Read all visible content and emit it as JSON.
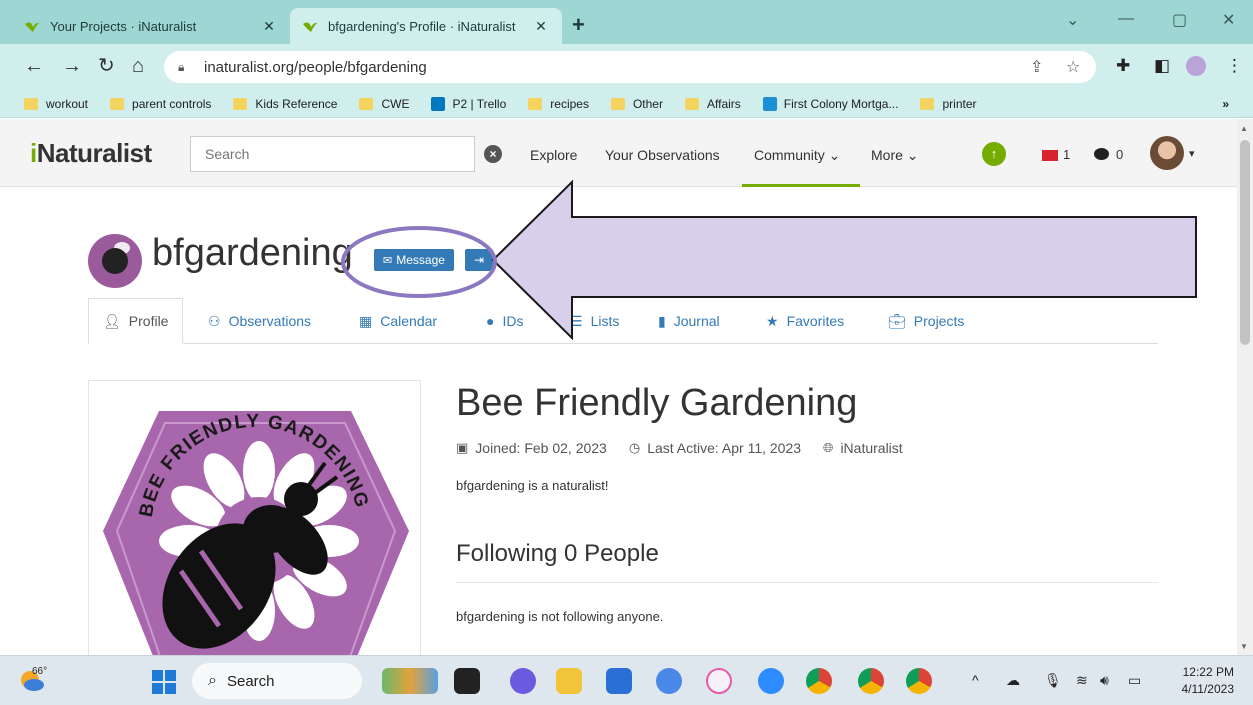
{
  "browser": {
    "tabs": [
      {
        "title": "Your Projects · iNaturalist",
        "active": false
      },
      {
        "title": "bfgardening's Profile · iNaturalist",
        "active": true
      }
    ],
    "new_tab_label": "+",
    "window_controls": {
      "dropdown": "⌄",
      "minimize": "—",
      "restore": "▢",
      "close": "✕"
    },
    "url": "inaturalist.org/people/bfgardening",
    "bookmarks": [
      {
        "label": "workout",
        "icon": "folder-icon"
      },
      {
        "label": "parent controls",
        "icon": "folder-icon"
      },
      {
        "label": "Kids Reference",
        "icon": "folder-icon"
      },
      {
        "label": "CWE",
        "icon": "folder-icon"
      },
      {
        "label": "P2 | Trello",
        "icon": "trello-icon"
      },
      {
        "label": "recipes",
        "icon": "folder-icon"
      },
      {
        "label": "Other",
        "icon": "folder-icon"
      },
      {
        "label": "Affairs",
        "icon": "folder-icon"
      },
      {
        "label": "First Colony Mortga...",
        "icon": "mortgage-icon"
      },
      {
        "label": "printer",
        "icon": "folder-icon"
      }
    ],
    "bookmarks_overflow": "»"
  },
  "site": {
    "logo": {
      "prefix": "i",
      "rest": "Naturalist"
    },
    "search_placeholder": "Search",
    "nav": {
      "explore": "Explore",
      "your_observations": "Your Observations",
      "community": "Community ⌄",
      "more": "More ⌄"
    },
    "messages_count": "1",
    "comments_count": "0",
    "accent_color": "#74ac00"
  },
  "profile": {
    "username": "bfgardening",
    "message_button": "Message",
    "tabs": [
      {
        "label": "Profile",
        "icon": "user-icon"
      },
      {
        "label": "Observations",
        "icon": "binoculars-icon"
      },
      {
        "label": "Calendar",
        "icon": "calendar-icon"
      },
      {
        "label": "IDs",
        "icon": "id-icon"
      },
      {
        "label": "Lists",
        "icon": "list-icon"
      },
      {
        "label": "Journal",
        "icon": "book-icon"
      },
      {
        "label": "Favorites",
        "icon": "star-icon"
      },
      {
        "label": "Projects",
        "icon": "briefcase-icon"
      }
    ],
    "display_name": "Bee Friendly Gardening",
    "joined": "Joined: Feb 02, 2023",
    "last_active": "Last Active: Apr 11, 2023",
    "network": "iNaturalist",
    "bio": "bfgardening is a naturalist!",
    "following_title": "Following 0 People",
    "following_empty": "bfgardening is not following anyone.",
    "badge_text": {
      "arc": "BEE FRIENDLY GARDENING",
      "tm": "™"
    }
  },
  "taskbar": {
    "temperature": "66°",
    "search_label": "Search",
    "time": "12:22 PM",
    "date": "4/11/2023"
  },
  "annotation": {
    "arrow_fill": "#d8d0ea",
    "circle_stroke": "#8c78c0"
  }
}
